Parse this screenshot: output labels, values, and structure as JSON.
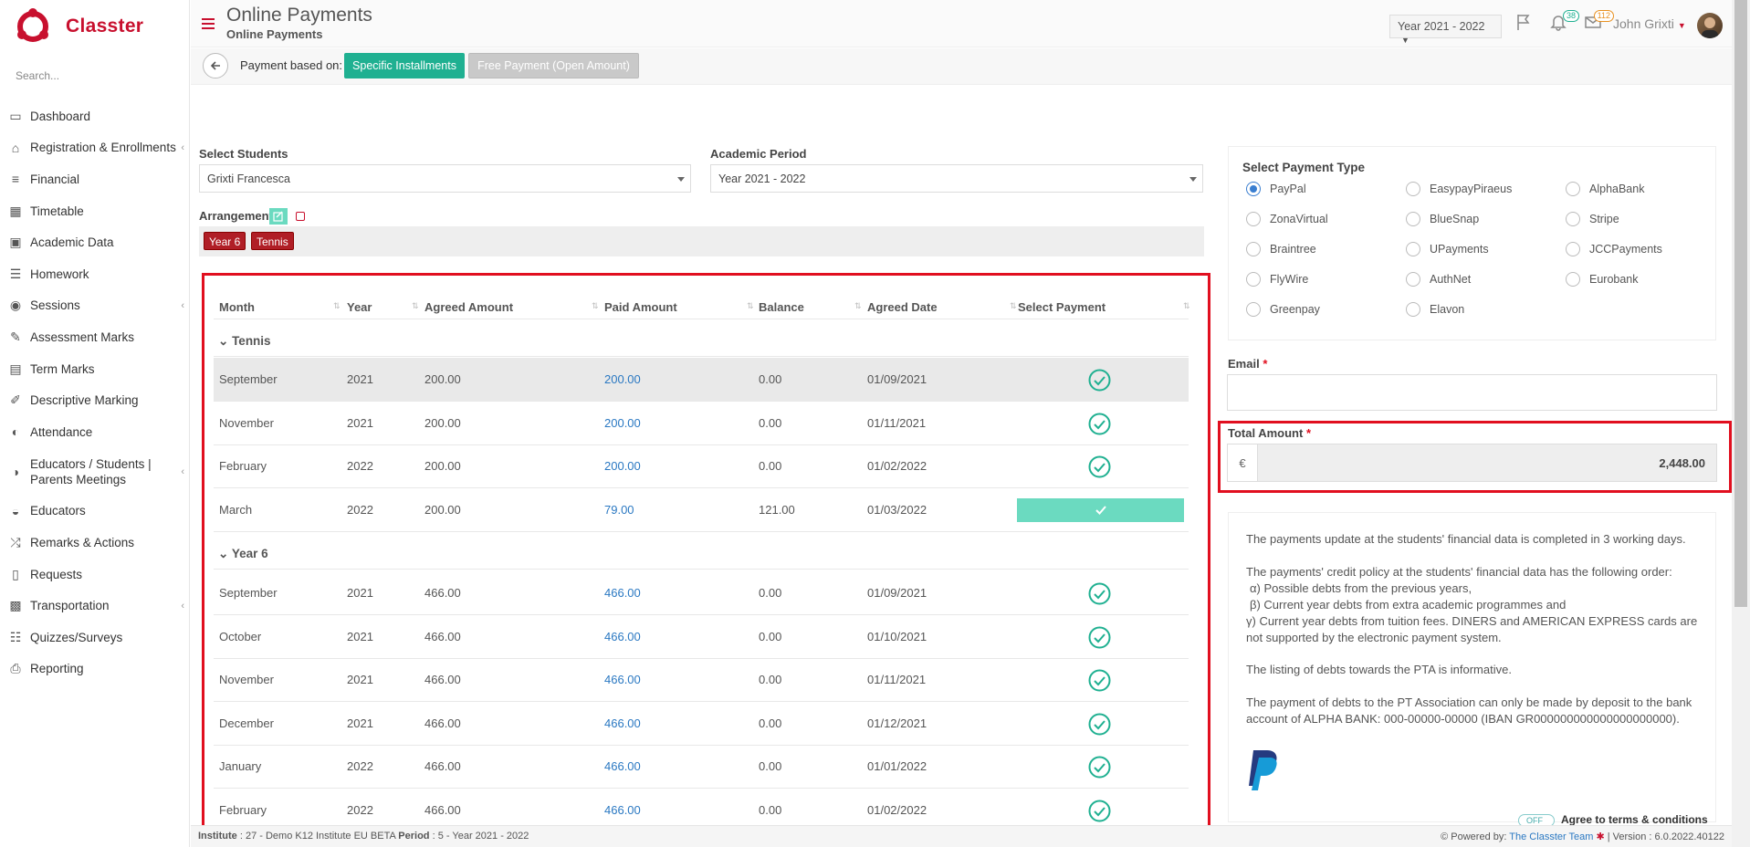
{
  "app": {
    "brand": "Classter",
    "search_placeholder": "Search..."
  },
  "sidebar": {
    "items": [
      {
        "label": "Dashboard",
        "icon": "laptop-icon",
        "chev": false
      },
      {
        "label": "Registration & Enrollments",
        "icon": "bank-icon",
        "chev": true
      },
      {
        "label": "Financial",
        "icon": "coins-icon",
        "chev": false
      },
      {
        "label": "Timetable",
        "icon": "calendar-icon",
        "chev": false
      },
      {
        "label": "Academic Data",
        "icon": "id-card-icon",
        "chev": false
      },
      {
        "label": "Homework",
        "icon": "list-icon",
        "chev": false
      },
      {
        "label": "Sessions",
        "icon": "users-icon",
        "chev": true
      },
      {
        "label": "Assessment Marks",
        "icon": "edit-icon",
        "chev": false
      },
      {
        "label": "Term Marks",
        "icon": "book-icon",
        "chev": false
      },
      {
        "label": "Descriptive Marking",
        "icon": "pencil-square-icon",
        "chev": false
      },
      {
        "label": "Attendance",
        "icon": "user-check-icon",
        "chev": false
      },
      {
        "label": "Educators / Students | Parents Meetings",
        "icon": "meeting-icon",
        "chev": true
      },
      {
        "label": "Educators",
        "icon": "educators-icon",
        "chev": false
      },
      {
        "label": "Remarks & Actions",
        "icon": "shuffle-icon",
        "chev": false
      },
      {
        "label": "Requests",
        "icon": "file-icon",
        "chev": false
      },
      {
        "label": "Transportation",
        "icon": "bus-icon",
        "chev": true
      },
      {
        "label": "Quizzes/Surveys",
        "icon": "checklist-icon",
        "chev": false
      },
      {
        "label": "Reporting",
        "icon": "print-icon",
        "chev": false
      }
    ]
  },
  "header": {
    "title": "Online Payments",
    "subtitle": "Online Payments",
    "year_select": "Year 2021 - 2022",
    "notifications_count": "38",
    "messages_count": "112",
    "user_name": "John Grixti"
  },
  "toolbar": {
    "payment_based_on": "Payment based on:",
    "specific": "Specific Installments",
    "free": "Free Payment (Open Amount)"
  },
  "form": {
    "students_label": "Select Students",
    "students_value": "Grixti Francesca",
    "period_label": "Academic Period",
    "period_value": "Year 2021 - 2022",
    "arrangement_label": "Arrangement",
    "tags": [
      "Year 6",
      "Tennis"
    ]
  },
  "table": {
    "columns": [
      "Month",
      "Year",
      "Agreed Amount",
      "Paid Amount",
      "Balance",
      "Agreed Date",
      "Select Payment"
    ],
    "groups": [
      {
        "name": "Tennis",
        "rows": [
          {
            "month": "September",
            "year": "2021",
            "agreed": "200.00",
            "paid": "200.00",
            "balance": "0.00",
            "date": "01/09/2021",
            "status": "paid"
          },
          {
            "month": "November",
            "year": "2021",
            "agreed": "200.00",
            "paid": "200.00",
            "balance": "0.00",
            "date": "01/11/2021",
            "status": "paid"
          },
          {
            "month": "February",
            "year": "2022",
            "agreed": "200.00",
            "paid": "200.00",
            "balance": "0.00",
            "date": "01/02/2022",
            "status": "paid"
          },
          {
            "month": "March",
            "year": "2022",
            "agreed": "200.00",
            "paid": "79.00",
            "balance": "121.00",
            "date": "01/03/2022",
            "status": "selected"
          }
        ]
      },
      {
        "name": "Year 6",
        "rows": [
          {
            "month": "September",
            "year": "2021",
            "agreed": "466.00",
            "paid": "466.00",
            "balance": "0.00",
            "date": "01/09/2021",
            "status": "paid"
          },
          {
            "month": "October",
            "year": "2021",
            "agreed": "466.00",
            "paid": "466.00",
            "balance": "0.00",
            "date": "01/10/2021",
            "status": "paid"
          },
          {
            "month": "November",
            "year": "2021",
            "agreed": "466.00",
            "paid": "466.00",
            "balance": "0.00",
            "date": "01/11/2021",
            "status": "paid"
          },
          {
            "month": "December",
            "year": "2021",
            "agreed": "466.00",
            "paid": "466.00",
            "balance": "0.00",
            "date": "01/12/2021",
            "status": "paid"
          },
          {
            "month": "January",
            "year": "2022",
            "agreed": "466.00",
            "paid": "466.00",
            "balance": "0.00",
            "date": "01/01/2022",
            "status": "paid"
          },
          {
            "month": "February",
            "year": "2022",
            "agreed": "466.00",
            "paid": "466.00",
            "balance": "0.00",
            "date": "01/02/2022",
            "status": "paid"
          }
        ]
      }
    ]
  },
  "payment_type": {
    "title": "Select Payment Type",
    "options": [
      "PayPal",
      "EasypayPiraeus",
      "AlphaBank",
      "ZonaVirtual",
      "BlueSnap",
      "Stripe",
      "Braintree",
      "UPayments",
      "JCCPayments",
      "FlyWire",
      "AuthNet",
      "Eurobank",
      "Greenpay",
      "Elavon"
    ],
    "selected": "PayPal"
  },
  "email": {
    "label": "Email",
    "value": ""
  },
  "total": {
    "label": "Total Amount",
    "currency": "€",
    "value": "2,448.00"
  },
  "info": {
    "p1": "The payments update at the students' financial data is completed in 3 working days.",
    "p2": "The payments' credit policy at the students' financial data has the following order:",
    "p2a": "α) Possible debts from the previous years,",
    "p2b": "β) Current year debts from extra academic programmes and",
    "p2c": "γ) Current year debts from tuition fees. DINERS and AMERICAN EXPRESS cards are not supported by the electronic payment system.",
    "p3": "The listing of debts towards the PTA is informative.",
    "p4": "The payment of debts to the PT Association can only be made by deposit to the bank account of ALPHA BANK: 000-00000-00000 (IBAN GR000000000000000000000).",
    "toggle": "OFF",
    "terms": "Agree to terms & conditions"
  },
  "footer": {
    "institute_label": "Institute",
    "institute_value": ": 27 - Demo K12 Institute EU BETA",
    "period_label": "Period",
    "period_value": ": 5 - Year 2021 - 2022",
    "powered": "Powered by:",
    "team": "The Classter Team",
    "version": "| Version : 6.0.2022.40122"
  },
  "colors": {
    "brand": "#c8102e",
    "accent": "#1fb091",
    "link": "#2a78c2",
    "highlight": "#e10f1f"
  }
}
